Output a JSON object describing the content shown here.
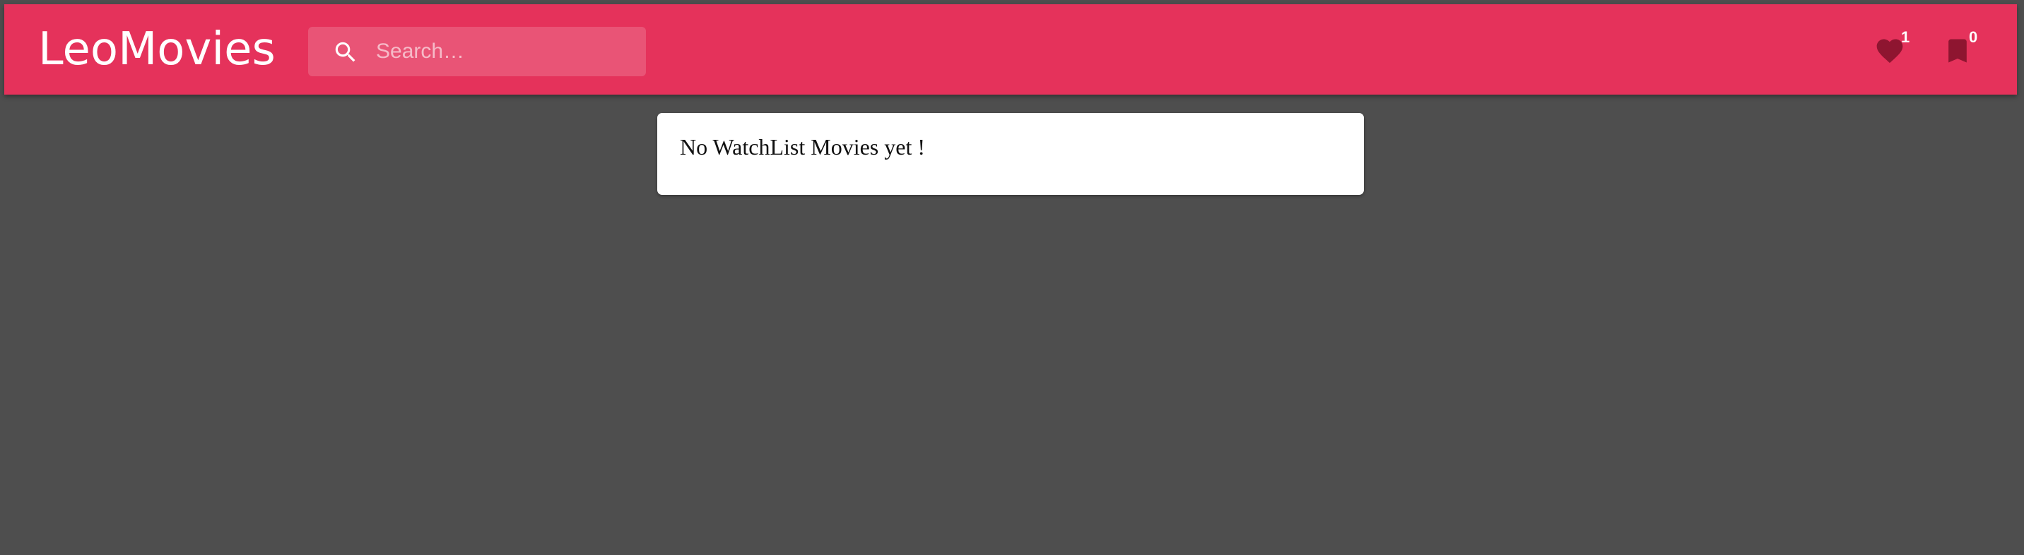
{
  "header": {
    "brand": "LeoMovies",
    "search": {
      "placeholder": "Search…",
      "value": "",
      "icon": "search-icon"
    },
    "favorites": {
      "icon": "heart-icon",
      "count": "1"
    },
    "watchlist": {
      "icon": "bookmark-icon",
      "count": "0"
    }
  },
  "main": {
    "empty_message": "No WatchList Movies yet !"
  },
  "colors": {
    "accent": "#e5325b",
    "background": "#4e4e4e",
    "icon_dark": "#8e1530"
  }
}
